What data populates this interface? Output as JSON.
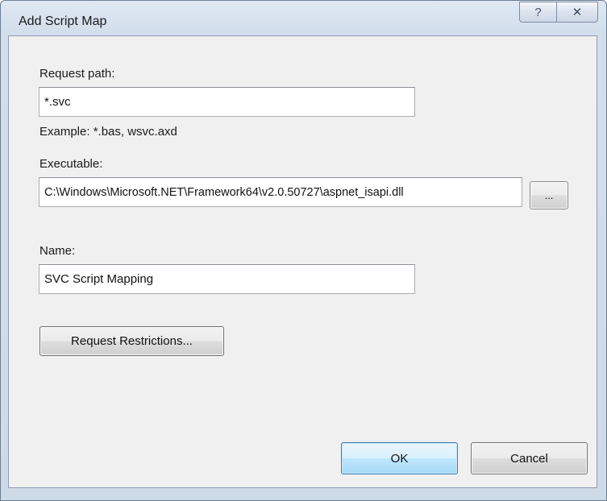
{
  "window": {
    "title": "Add Script Map",
    "help_glyph": "?",
    "close_glyph": "✕"
  },
  "request_path": {
    "label": "Request path:",
    "value": "*.svc",
    "example": "Example: *.bas, wsvc.axd"
  },
  "executable": {
    "label": "Executable:",
    "value": "C:\\Windows\\Microsoft.NET\\Framework64\\v2.0.50727\\aspnet_isapi.dll",
    "browse_label": "..."
  },
  "name": {
    "label": "Name:",
    "value": "SVC Script Mapping"
  },
  "buttons": {
    "restrictions_label": "Request Restrictions...",
    "ok_label": "OK",
    "cancel_label": "Cancel"
  },
  "colors": {
    "accent_default_button": "#3c7fb1",
    "client_background": "#f0f0f0"
  }
}
